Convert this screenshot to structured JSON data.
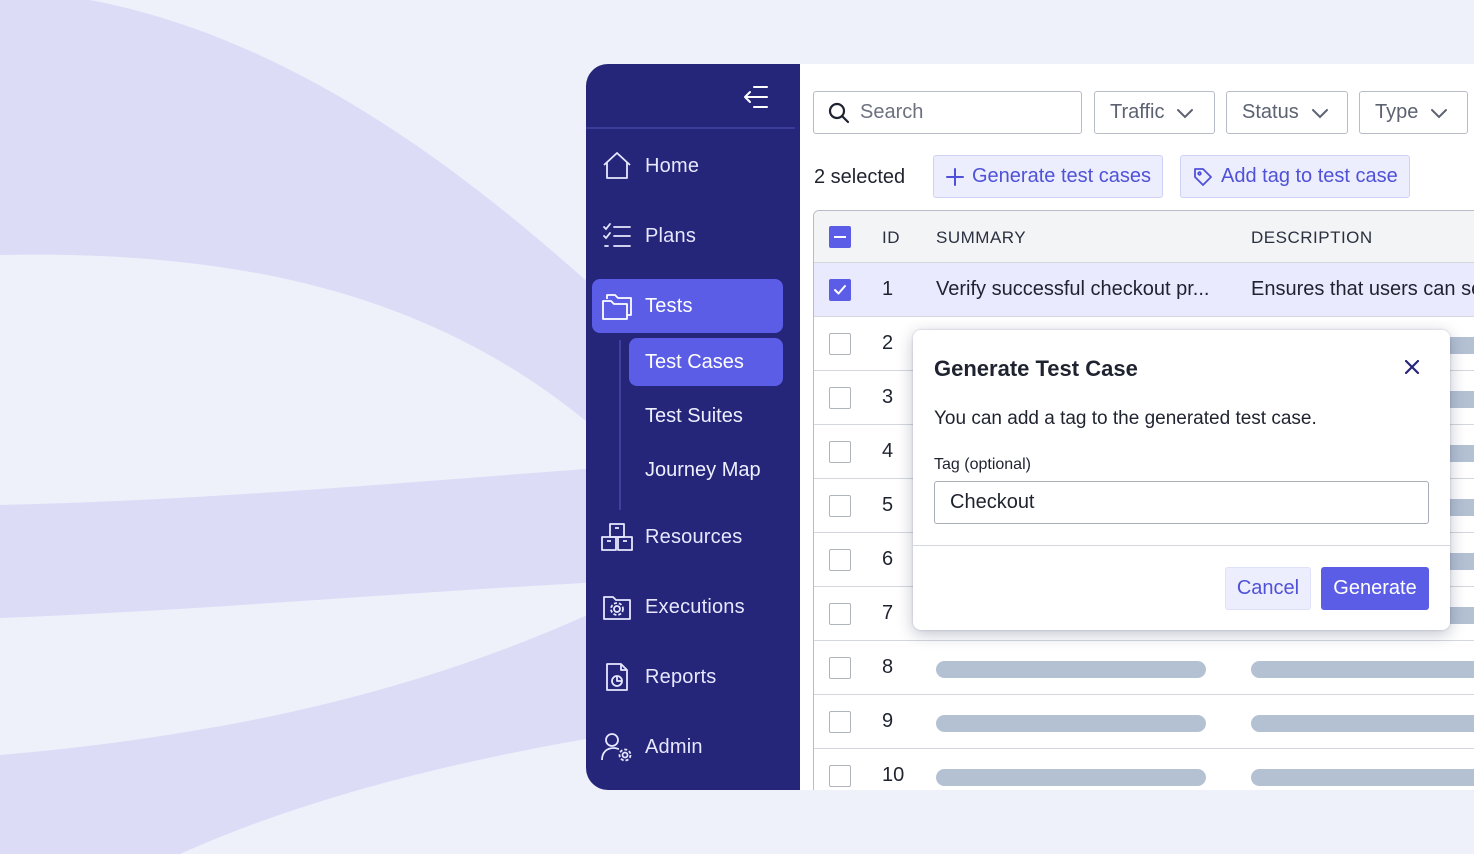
{
  "colors": {
    "sidebar_bg": "#25257a",
    "accent": "#5b5de6",
    "page_bg": "#eef0fa",
    "skeleton": "#b4c1d3"
  },
  "sidebar": {
    "collapse_icon": "collapse-menu-icon",
    "items": [
      {
        "label": "Home",
        "icon": "home-icon"
      },
      {
        "label": "Plans",
        "icon": "checklist-icon"
      },
      {
        "label": "Tests",
        "icon": "folder-icon",
        "active": true
      },
      {
        "label": "Resources",
        "icon": "boxes-icon"
      },
      {
        "label": "Executions",
        "icon": "folder-gear-icon"
      },
      {
        "label": "Reports",
        "icon": "report-icon"
      },
      {
        "label": "Admin",
        "icon": "user-gear-icon"
      }
    ],
    "sub_items": [
      {
        "label": "Test Cases",
        "active": true
      },
      {
        "label": "Test Suites"
      },
      {
        "label": "Journey Map"
      }
    ]
  },
  "toolbar": {
    "search_placeholder": "Search",
    "filters": [
      "Traffic",
      "Status",
      "Type"
    ],
    "selected_count": "2 selected",
    "generate_label": "Generate test cases",
    "add_tag_label": "Add tag to test case"
  },
  "table": {
    "columns": [
      "ID",
      "SUMMARY",
      "DESCRIPTION"
    ],
    "rows": [
      {
        "id": "1",
        "summary": "Verify successful checkout pr...",
        "description": "Ensures that users can se",
        "checked": true
      },
      {
        "id": "2"
      },
      {
        "id": "3"
      },
      {
        "id": "4"
      },
      {
        "id": "5"
      },
      {
        "id": "6"
      },
      {
        "id": "7"
      },
      {
        "id": "8"
      },
      {
        "id": "9"
      },
      {
        "id": "10"
      }
    ]
  },
  "modal": {
    "title": "Generate Test Case",
    "text": "You can add a tag to the generated test case.",
    "field_label": "Tag (optional)",
    "field_value": "Checkout",
    "cancel_label": "Cancel",
    "generate_label": "Generate"
  }
}
